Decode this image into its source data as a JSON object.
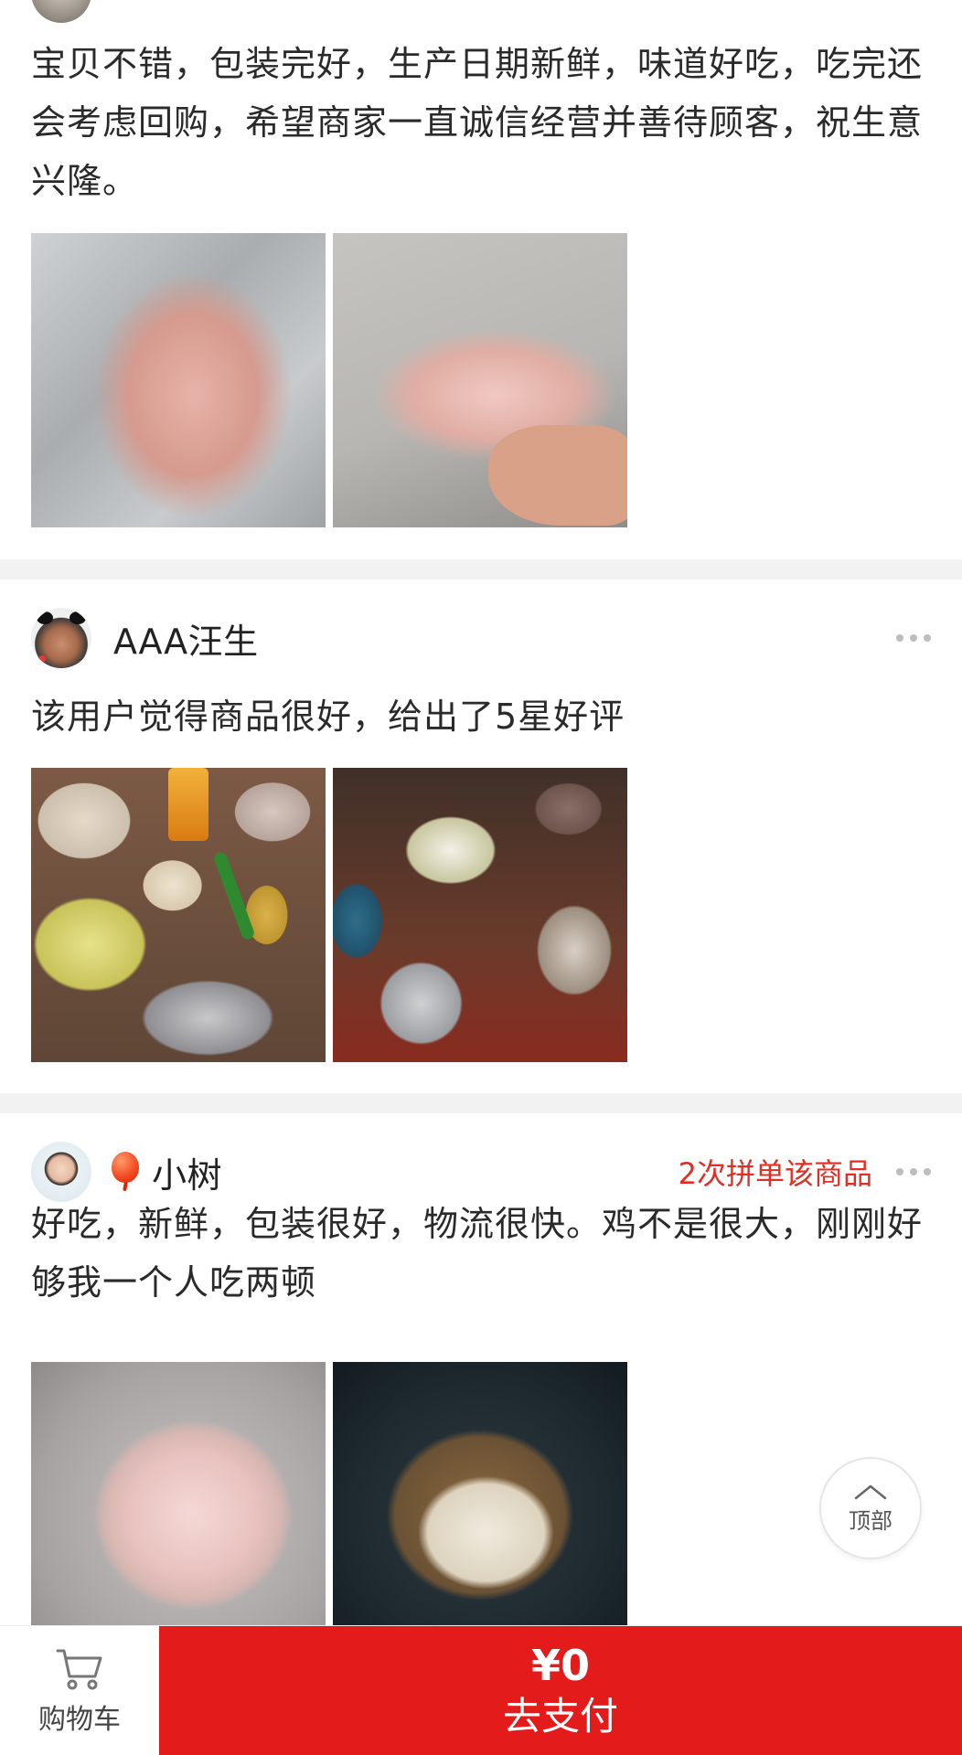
{
  "reviews": [
    {
      "text": "宝贝不错，包装完好，生产日期新鲜，味道好吃，吃完还会考虑回购，希望商家一直诚信经营并善待顾客，祝生意兴隆。",
      "photos": [
        "review-photo-1",
        "review-photo-2"
      ]
    },
    {
      "username": "AAA汪生",
      "text": "该用户觉得商品很好，给出了5星好评",
      "photos": [
        "review-photo-1",
        "review-photo-2"
      ]
    },
    {
      "username": "小树",
      "badge": "2次拼单该商品",
      "text": "好吃，新鲜，包装很好，物流很快。鸡不是很大，刚刚好够我一个人吃两顿",
      "photos": [
        "review-photo-1",
        "review-photo-2"
      ]
    }
  ],
  "back_to_top": {
    "label": "顶部",
    "icon": "chevron-up-icon"
  },
  "bottom_bar": {
    "cart_label": "购物车",
    "cart_icon": "shopping-cart-icon",
    "price": "¥0",
    "pay_label": "去支付",
    "pay_color": "#e31b1b"
  },
  "colors": {
    "accent_red": "#e02e24",
    "separator": "#f2f2f2"
  }
}
